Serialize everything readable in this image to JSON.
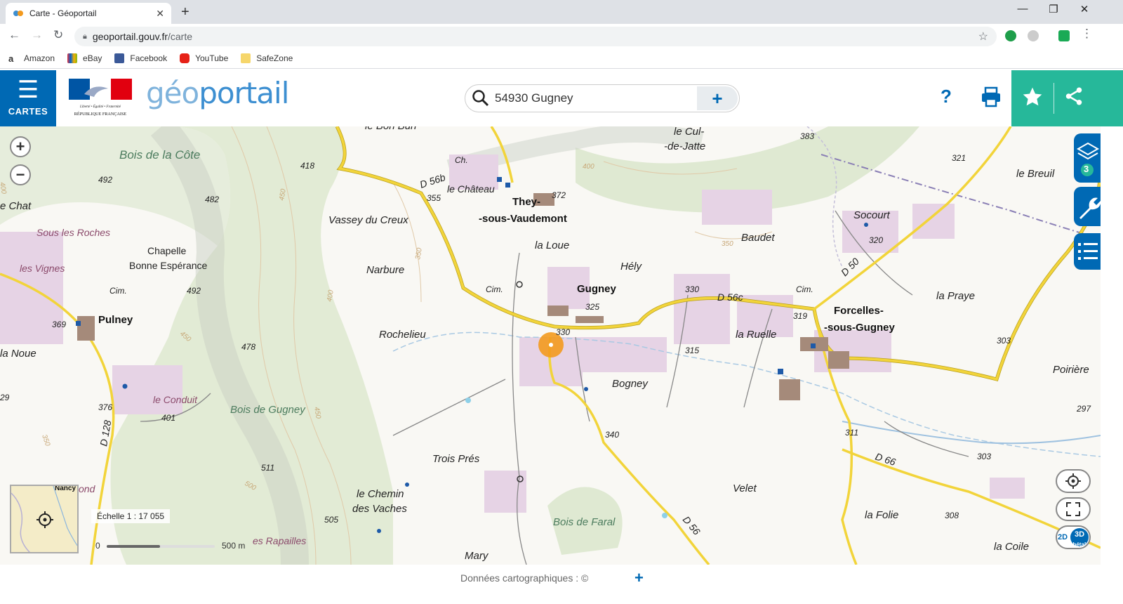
{
  "browser": {
    "tab_title": "Carte - Géoportail",
    "url_domain": "geoportail.gouv.fr",
    "url_path": "/carte",
    "bookmarks": [
      "Amazon",
      "eBay",
      "Facebook",
      "YouTube",
      "SafeZone"
    ]
  },
  "header": {
    "menu_label": "CARTES",
    "logo_text_geo": "géo",
    "logo_text_portail": "portail",
    "flag_line1": "Liberté • Égalité • Fraternité",
    "flag_line2": "RÉPUBLIQUE FRANÇAISE",
    "search_value": "54930 Gugney",
    "help_label": "?"
  },
  "map": {
    "towns": {
      "they": "They-",
      "vaudemont": "-sous-Vaudemont",
      "gugney": "Gugney",
      "pulney": "Pulney",
      "forcelles": "Forcelles-",
      "sousgugney": "-sous-Gugney"
    },
    "places": {
      "bondun": "le Bon Bun",
      "culdejatte1": "le Cul-",
      "culdejatte2": "-de-Jatte",
      "chateau": "le Château",
      "ch": "Ch.",
      "vassey": "Vassey du Creux",
      "laloue": "la Loue",
      "narbure": "Narbure",
      "hely": "Hély",
      "baudet": "Baudet",
      "socourt": "Socourt",
      "lebreuil": "le Breuil",
      "lapraye": "la Praye",
      "rochelieu": "Rochelieu",
      "laruelle": "la Ruelle",
      "bogney": "Bogney",
      "poiriere": "Poirière",
      "chapelle1": "Chapelle",
      "chapelle2": "Bonne Espérance",
      "echat": "e Chat",
      "lanoue": "la Noue",
      "leconduit": "le Conduit",
      "troispres": "Trois Prés",
      "chemin1": "le Chemin",
      "chemin2": "des Vaches",
      "velet": "Velet",
      "lafolie": "la Folie",
      "lacoile": "la Coile",
      "mary": "Mary",
      "rapailles": "es Rapailles",
      "ond": "ond",
      "cim1": "Cim.",
      "cim2": "Cim.",
      "cim3": "Cim."
    },
    "lieux": {
      "sousroches": "Sous les Roches",
      "lesvignes": "les Vignes"
    },
    "forests": {
      "boiscote": "Bois de la Côte",
      "boisgugney": "Bois de Gugney",
      "boisfaral": "Bois de Faral"
    },
    "roads": {
      "d56b": "D 56b",
      "d56c": "D 56c",
      "d50": "D 50",
      "d66": "D 66",
      "d56": "D 56",
      "d128": "D 128"
    },
    "altitudes": {
      "a418": "418",
      "a492a": "492",
      "a482": "482",
      "a492b": "492",
      "a369": "369",
      "a478": "478",
      "a376": "376",
      "a401": "401",
      "a511": "511",
      "a505": "505",
      "a355": "355",
      "a372": "372",
      "a325": "325",
      "a330a": "330",
      "a330b": "330",
      "a315": "315",
      "a340": "340",
      "a383": "383",
      "a321": "321",
      "a320": "320",
      "a319": "319",
      "a303a": "303",
      "a297": "297",
      "a311": "311",
      "a303b": "303",
      "a308": "308",
      "a29": "29"
    },
    "contours": {
      "c450a": "450",
      "c350a": "350",
      "c400a": "400",
      "c450b": "450",
      "c400b": "400",
      "c350b": "350",
      "c450c": "450",
      "c500": "500",
      "c350c": "350",
      "c400c": "400"
    },
    "minimap_town": "Nancy",
    "scale_text": "Échelle 1 : 17 055",
    "scale_zero": "0",
    "scale_max": "500 m",
    "layer_count": "3",
    "mode_2d": "2D",
    "mode_3d": "3D",
    "mode_beta": "béta²"
  },
  "footer": {
    "credits": "Données cartographiques : ©"
  },
  "colors": {
    "brand_blue": "#0069b4",
    "brand_green": "#26b89a",
    "road_yellow": "#f2d43a",
    "forest_green": "#dfe9d2",
    "urban_pink": "#e6d3e5",
    "marker_orange": "#f39a1e"
  }
}
